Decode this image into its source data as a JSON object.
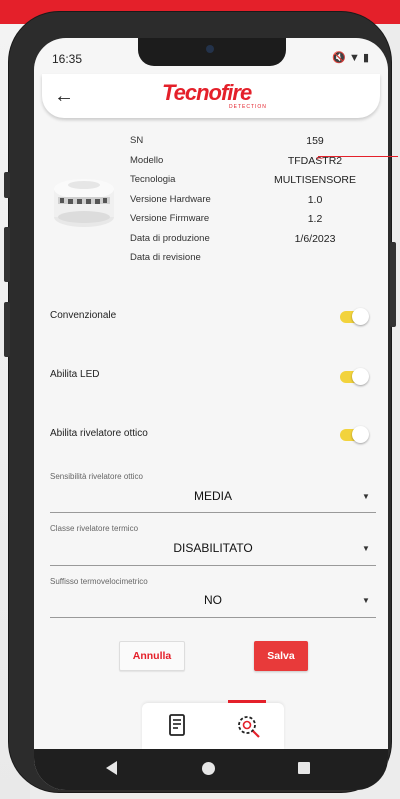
{
  "status_bar": {
    "time": "16:35"
  },
  "header": {
    "back_icon": "arrow-left-icon",
    "logo_text": "Tecnofire",
    "logo_subtitle": "DETECTION"
  },
  "device_info": [
    {
      "label": "SN",
      "value": "159"
    },
    {
      "label": "Modello",
      "value": "TFDASTR2"
    },
    {
      "label": "Tecnologia",
      "value": "MULTISENSORE"
    },
    {
      "label": "Versione Hardware",
      "value": "1.0"
    },
    {
      "label": "Versione Firmware",
      "value": "1.2"
    },
    {
      "label": "Data di produzione",
      "value": "1/6/2023"
    },
    {
      "label": "Data di revisione",
      "value": ""
    }
  ],
  "toggles": [
    {
      "label": "Convenzionale",
      "on": true
    },
    {
      "label": "Abilita LED",
      "on": true
    },
    {
      "label": "Abilita rivelatore ottico",
      "on": true
    }
  ],
  "selects": [
    {
      "label": "Sensibilità rivelatore ottico",
      "value": "MEDIA"
    },
    {
      "label": "Classe rivelatore termico",
      "value": "DISABILITATO"
    },
    {
      "label": "Suffisso termovelocimetrico",
      "value": "NO"
    }
  ],
  "actions": {
    "cancel": "Annulla",
    "save": "Salva"
  },
  "colors": {
    "accent": "#e4202a",
    "toggle_on": "#f2d33c"
  },
  "tabs": [
    {
      "icon": "document-list-icon"
    },
    {
      "icon": "settings-search-icon",
      "active": true
    }
  ]
}
